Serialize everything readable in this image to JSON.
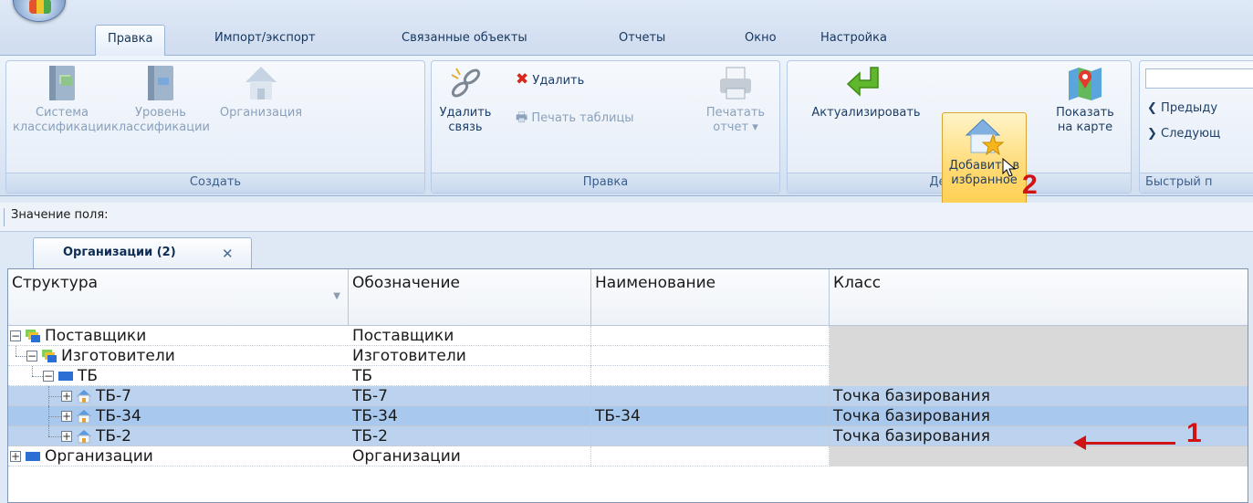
{
  "tabs": [
    "Правка",
    "Импорт/экспорт",
    "Связанные объекты",
    "Отчеты",
    "Окно",
    "Настройка"
  ],
  "ribbon": {
    "groups": [
      "Создать",
      "Правка",
      "Действия",
      "Быстрый п"
    ],
    "create": {
      "system": "Система\nклассификации",
      "level": "Уровень\nклассификации",
      "organization": "Организация"
    },
    "edit": {
      "delete_link": "Удалить\nсвязь",
      "delete": "Удалить",
      "print_table": "Печать таблицы",
      "print_report": "Печатать\nотчет ▾"
    },
    "actions": {
      "actualize": "Актуализировать",
      "add_favorites": "Добавить в\nизбранное",
      "show_on_map": "Показать\nна карте"
    },
    "quick": {
      "previous": "Предыду",
      "next": "Следующ"
    }
  },
  "field_bar": {
    "label": "Значение поля:"
  },
  "document_tab": {
    "label": "Организации (2)"
  },
  "grid": {
    "columns": [
      "Структура",
      "Обозначение",
      "Наименование",
      "Класс"
    ],
    "rows": [
      {
        "structure": "Поставщики",
        "designation": "Поставщики",
        "name": "",
        "class": ""
      },
      {
        "structure": "Изготовители",
        "designation": "Изготовители",
        "name": "",
        "class": ""
      },
      {
        "structure": "ТБ",
        "designation": "ТБ",
        "name": "",
        "class": ""
      },
      {
        "structure": "ТБ-7",
        "designation": "ТБ-7",
        "name": "",
        "class": "Точка базирования"
      },
      {
        "structure": "ТБ-34",
        "designation": "ТБ-34",
        "name": "ТБ-34",
        "class": "Точка базирования"
      },
      {
        "structure": "ТБ-2",
        "designation": "ТБ-2",
        "name": "",
        "class": "Точка базирования"
      },
      {
        "structure": "Организации",
        "designation": "Организации",
        "name": "",
        "class": ""
      }
    ]
  },
  "annotations": {
    "step1": "1",
    "step2": "2"
  },
  "colors": {
    "selection": "#bcd3ef",
    "highlight": "#ffd86e",
    "annotation": "#d01313"
  }
}
